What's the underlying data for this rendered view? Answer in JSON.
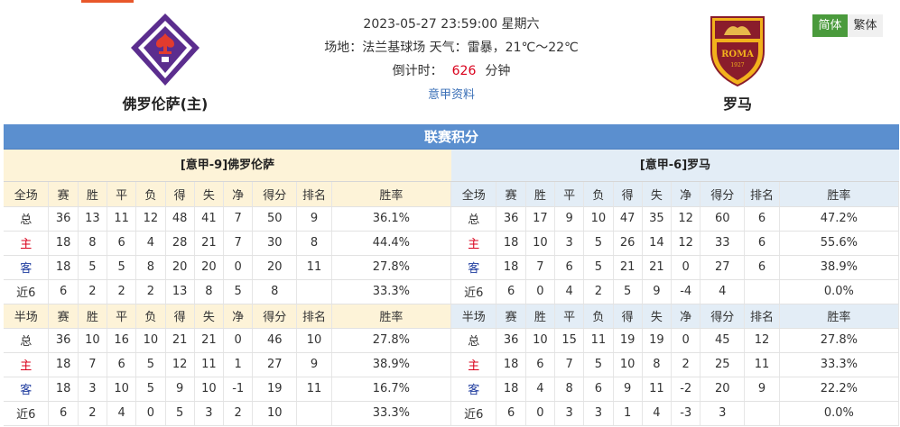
{
  "match": {
    "datetime": "2023-05-27 23:59:00 星期六",
    "venue_line": "场地：法兰基球场 天气：雷暴，21℃～22℃",
    "countdown_label": "倒计时：",
    "countdown_value": "626",
    "countdown_unit": "分钟",
    "league_link": "意甲资料"
  },
  "home": {
    "name": "佛罗伦萨(主)"
  },
  "away": {
    "name": "罗马",
    "logo_text": "ROMA",
    "logo_year": "1927"
  },
  "lang": {
    "simplified": "简体",
    "traditional": "繁体"
  },
  "colors": {
    "accent_bar": "#5b8fcf",
    "highlight_red": "#d9001b",
    "lang_active": "#4a9a3c"
  },
  "section_title": "联赛积分",
  "panels": {
    "left": {
      "title": "[意甲-9]佛罗伦萨",
      "full_header": [
        "全场",
        "赛",
        "胜",
        "平",
        "负",
        "得",
        "失",
        "净",
        "得分",
        "排名",
        "胜率"
      ],
      "full_rows": [
        [
          "总",
          "36",
          "13",
          "11",
          "12",
          "48",
          "41",
          "7",
          "50",
          "9",
          "36.1%"
        ],
        [
          "主",
          "18",
          "8",
          "6",
          "4",
          "28",
          "21",
          "7",
          "30",
          "8",
          "44.4%"
        ],
        [
          "客",
          "18",
          "5",
          "5",
          "8",
          "20",
          "20",
          "0",
          "20",
          "11",
          "27.8%"
        ],
        [
          "近6",
          "6",
          "2",
          "2",
          "2",
          "13",
          "8",
          "5",
          "8",
          "",
          "33.3%"
        ]
      ],
      "half_header": [
        "半场",
        "赛",
        "胜",
        "平",
        "负",
        "得",
        "失",
        "净",
        "得分",
        "排名",
        "胜率"
      ],
      "half_rows": [
        [
          "总",
          "36",
          "10",
          "16",
          "10",
          "21",
          "21",
          "0",
          "46",
          "10",
          "27.8%"
        ],
        [
          "主",
          "18",
          "7",
          "6",
          "5",
          "12",
          "11",
          "1",
          "27",
          "9",
          "38.9%"
        ],
        [
          "客",
          "18",
          "3",
          "10",
          "5",
          "9",
          "10",
          "-1",
          "19",
          "11",
          "16.7%"
        ],
        [
          "近6",
          "6",
          "2",
          "4",
          "0",
          "5",
          "3",
          "2",
          "10",
          "",
          "33.3%"
        ]
      ]
    },
    "right": {
      "title": "[意甲-6]罗马",
      "full_header": [
        "全场",
        "赛",
        "胜",
        "平",
        "负",
        "得",
        "失",
        "净",
        "得分",
        "排名",
        "胜率"
      ],
      "full_rows": [
        [
          "总",
          "36",
          "17",
          "9",
          "10",
          "47",
          "35",
          "12",
          "60",
          "6",
          "47.2%"
        ],
        [
          "主",
          "18",
          "10",
          "3",
          "5",
          "26",
          "14",
          "12",
          "33",
          "6",
          "55.6%"
        ],
        [
          "客",
          "18",
          "7",
          "6",
          "5",
          "21",
          "21",
          "0",
          "27",
          "6",
          "38.9%"
        ],
        [
          "近6",
          "6",
          "0",
          "4",
          "2",
          "5",
          "9",
          "-4",
          "4",
          "",
          "0.0%"
        ]
      ],
      "half_header": [
        "半场",
        "赛",
        "胜",
        "平",
        "负",
        "得",
        "失",
        "净",
        "得分",
        "排名",
        "胜率"
      ],
      "half_rows": [
        [
          "总",
          "36",
          "10",
          "15",
          "11",
          "19",
          "19",
          "0",
          "45",
          "12",
          "27.8%"
        ],
        [
          "主",
          "18",
          "6",
          "7",
          "5",
          "10",
          "8",
          "2",
          "25",
          "11",
          "33.3%"
        ],
        [
          "客",
          "18",
          "4",
          "8",
          "6",
          "9",
          "11",
          "-2",
          "20",
          "9",
          "22.2%"
        ],
        [
          "近6",
          "6",
          "0",
          "3",
          "3",
          "1",
          "4",
          "-3",
          "3",
          "",
          "0.0%"
        ]
      ]
    }
  }
}
